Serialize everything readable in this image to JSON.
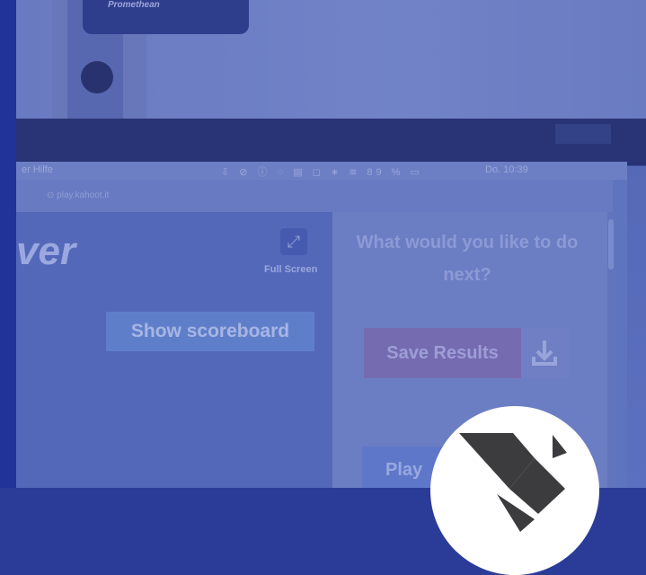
{
  "photo": {
    "projector_brand": "Promethean",
    "menubar": {
      "left_text": "er   Hilfe",
      "status_text": "⇩ ⊘ ⓘ ◌ ▤ ◻ ∗ ≋ 89 % ▭",
      "clock": "Do. 10:39"
    },
    "browser_url": "⊙ play.kahoot.it",
    "kahoot_logo_fragment": "ver",
    "fullscreen_label": "Full Screen",
    "show_scoreboard_label": "Show scoreboard",
    "next_heading": "What would you like to do next?",
    "save_results_label": "Save Results",
    "play_label": "Play"
  },
  "colors": {
    "overlay_tint": "#1c2e96",
    "badge_background": "#ffffff",
    "badge_mark": "#3c3c3f"
  },
  "badge": {
    "icon": "folded-bird-logo-icon"
  }
}
